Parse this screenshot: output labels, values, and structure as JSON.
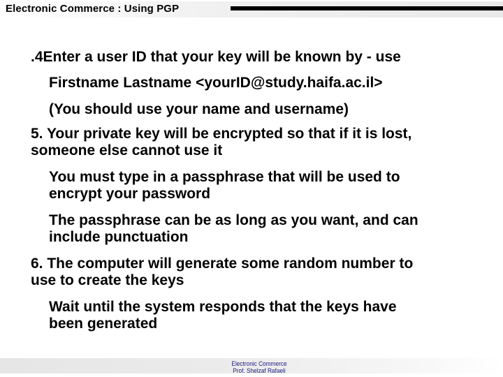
{
  "header": {
    "title": "Electronic Commerce :  Using PGP"
  },
  "body": {
    "lines": [
      ".4Enter a user ID that your key will be known by - use",
      "Firstname Lastname  <yourID@study.haifa.ac.il>",
      "(You should use your name and username)",
      "5. Your private key will be encrypted so that if it is lost,",
      "someone else cannot use it",
      "You must type in a passphrase that will be used to",
      "encrypt your password",
      "The passphrase can be as long as you want, and can",
      "include punctuation",
      "6. The computer will generate some random number to",
      "use to create the keys",
      "Wait until the system responds that the keys have",
      "been generated"
    ]
  },
  "footer": {
    "line1": "Electronic Commerce",
    "line2": "Prof. Shelzaf Rafaeli"
  },
  "colors": {
    "text": "#000000",
    "footer_text": "#1a1a80"
  }
}
